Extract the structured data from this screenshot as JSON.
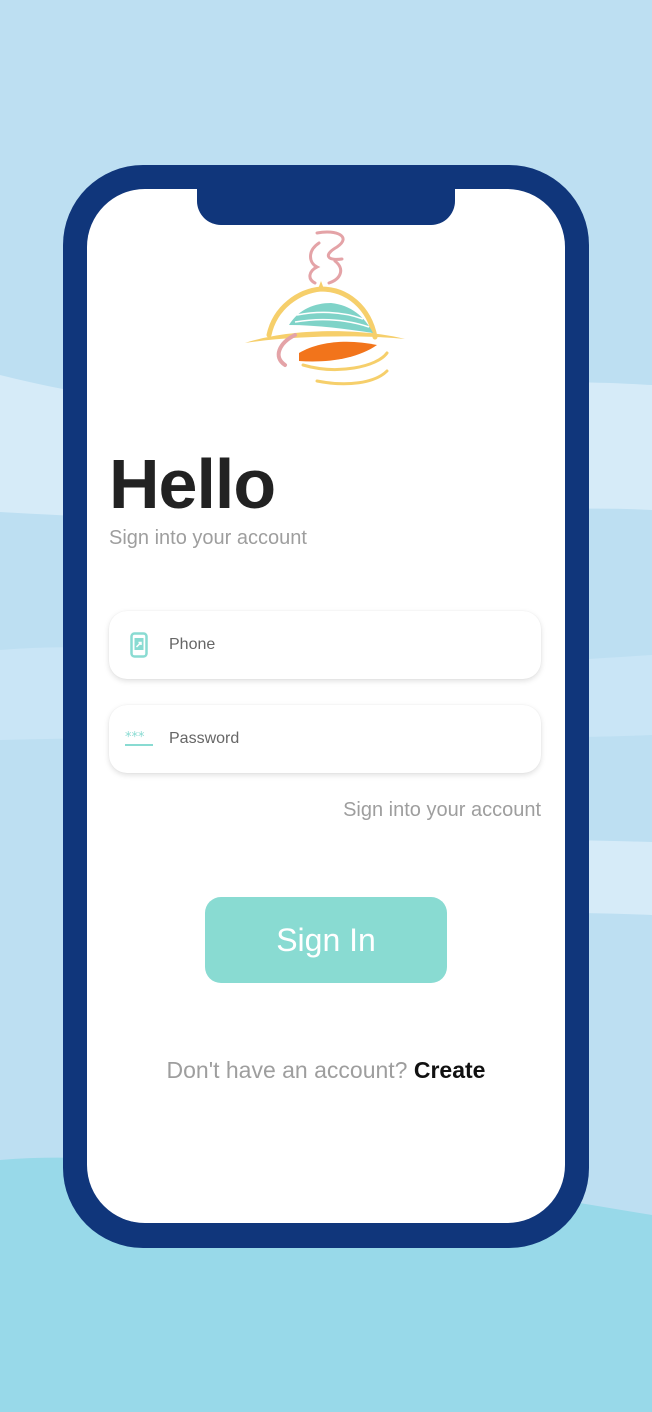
{
  "header": {
    "title": "Hello",
    "subtitle": "Sign into your account"
  },
  "form": {
    "phone_placeholder": "Phone",
    "password_placeholder": "Password",
    "forgot_link": "Sign into your account",
    "signin_label": "Sign In"
  },
  "footer": {
    "prompt": "Don't have an account?",
    "create_label": "Create"
  },
  "icons": {
    "logo": "food-cloche-logo-icon",
    "phone": "phone-icon",
    "password": "password-icon"
  },
  "colors": {
    "phone_frame": "#10367b",
    "accent": "#89dbd2",
    "background": "#bddff2",
    "muted_text": "#9e9e9e",
    "title_text": "#222222"
  }
}
